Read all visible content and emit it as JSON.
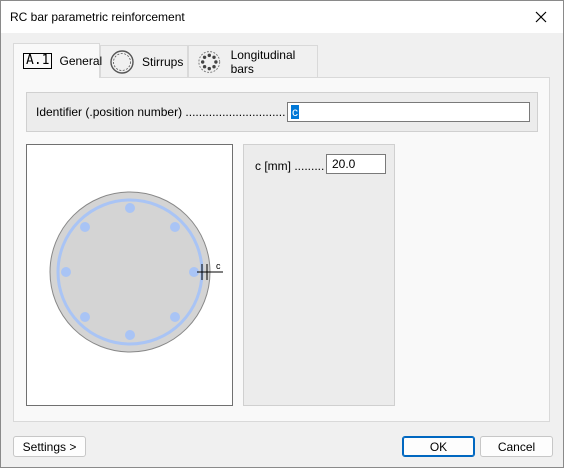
{
  "window": {
    "title": "RC bar parametric reinforcement"
  },
  "tabs": [
    {
      "icon_text": "A.1",
      "label": "General",
      "active": true
    },
    {
      "icon": "stirrup-ring-icon",
      "label": "Stirrups",
      "active": false
    },
    {
      "icon": "longitudinal-bars-icon",
      "label": "Longitudinal bars",
      "active": false
    }
  ],
  "general": {
    "identifier_label": "Identifier (.position number) ..............................",
    "identifier_value": "c"
  },
  "preview": {
    "dimension_label": "c"
  },
  "params": [
    {
      "label": "c [mm] .........",
      "value": "20.0"
    }
  ],
  "footer": {
    "settings_label": "Settings >",
    "ok_label": "OK",
    "cancel_label": "Cancel"
  },
  "colors": {
    "section_fill": "#d4d4d4",
    "rebar_blue": "#a9c4f5",
    "selection": "#0078d7"
  }
}
